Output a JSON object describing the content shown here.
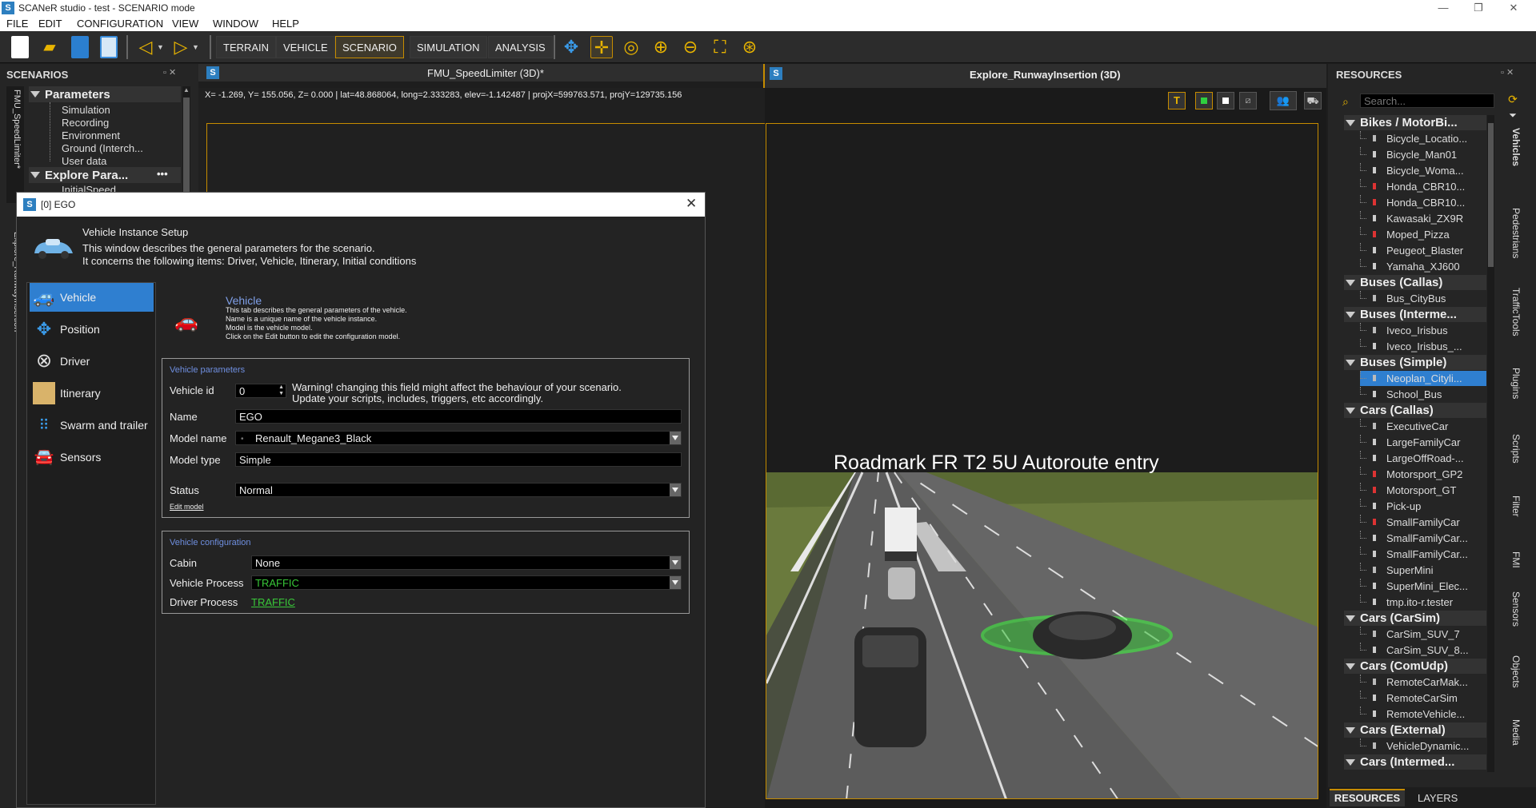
{
  "window": {
    "title": "SCANeR studio - test - SCENARIO mode",
    "icon_letter": "S"
  },
  "menu": [
    "FILE",
    "EDIT",
    "CONFIGURATION",
    "VIEW",
    "WINDOW",
    "HELP"
  ],
  "toolbar": {
    "modes": [
      "TERRAIN",
      "VEHICLE",
      "SCENARIO",
      "SIMULATION",
      "ANALYSIS"
    ],
    "active_mode": "SCENARIO"
  },
  "scenarios_panel": {
    "title": "SCENARIOS",
    "tabs": [
      "FMU_SpeedLimiter*",
      "Explore_RunwayInsertion"
    ],
    "parameters_header": "Parameters",
    "parameters_items": [
      "Simulation",
      "Recording",
      "Environment",
      "Ground (Interch...",
      "User data"
    ],
    "explore_header": "Explore Para...",
    "explore_more": "•••",
    "explore_items": [
      "InitialSpeed"
    ]
  },
  "views": {
    "left_tab_title": "FMU_SpeedLimiter (3D)*",
    "right_tab_title": "Explore_RunwayInsertion (3D)",
    "coordinates": "X= -1.269, Y= 155.056, Z= 0.000 | lat=48.868064, long=2.333283, elev=-1.142487 | projX=599763.571, projY=129735.156",
    "view_buttons": [
      "T"
    ],
    "roadmark_label": "Roadmark  FR  T2  5U  Autoroute entry"
  },
  "dialog": {
    "title": "[0] EGO",
    "header_title": "Vehicle Instance Setup",
    "header_desc_1": "This window describes the general parameters for the scenario.",
    "header_desc_2": "It concerns the following items: Driver, Vehicle, Itinerary, Initial conditions",
    "nav": [
      "Vehicle",
      "Position",
      "Driver",
      "Itinerary",
      "Swarm and trailer",
      "Sensors"
    ],
    "tab_title": "Vehicle",
    "tab_desc": [
      "This tab describes the general parameters of the vehicle.",
      "Name is a unique name of the vehicle instance.",
      "Model is the vehicle model.",
      "Click on the Edit button to edit the configuration model."
    ],
    "params_group": "Vehicle parameters",
    "vehicle_id_label": "Vehicle id",
    "vehicle_id_value": "0",
    "warning_1": "Warning! changing this field might affect the behaviour of your scenario.",
    "warning_2": "Update your scripts, includes, triggers, etc accordingly.",
    "name_label": "Name",
    "name_value": "EGO",
    "model_name_label": "Model name",
    "model_name_value": "Renault_Megane3_Black",
    "model_type_label": "Model type",
    "model_type_value": "Simple",
    "status_label": "Status",
    "status_value": "Normal",
    "edit_model": "Edit model",
    "config_group": "Vehicle configuration",
    "cabin_label": "Cabin",
    "cabin_value": "None",
    "vehicle_process_label": "Vehicle Process",
    "vehicle_process_value": "TRAFFIC",
    "driver_process_label": "Driver Process",
    "driver_process_value": "TRAFFIC"
  },
  "resources": {
    "title": "RESOURCES",
    "search_placeholder": "Search...",
    "groups": [
      {
        "name": "Bikes / MotorBi...",
        "items": [
          "Bicycle_Locatio...",
          "Bicycle_Man01",
          "Bicycle_Woma...",
          "Honda_CBR10...",
          "Honda_CBR10...",
          "Kawasaki_ZX9R",
          "Moped_Pizza",
          "Peugeot_Blaster",
          "Yamaha_XJ600"
        ]
      },
      {
        "name": "Buses (Callas)",
        "items": [
          "Bus_CityBus"
        ]
      },
      {
        "name": "Buses (Interme...",
        "items": [
          "Iveco_Irisbus",
          "Iveco_Irisbus_..."
        ]
      },
      {
        "name": "Buses (Simple)",
        "items": [
          "Neoplan_Cityli...",
          "School_Bus"
        ]
      },
      {
        "name": "Cars (Callas)",
        "items": [
          "ExecutiveCar",
          "LargeFamilyCar",
          "LargeOffRoad-...",
          "Motorsport_GP2",
          "Motorsport_GT",
          "Pick-up",
          "SmallFamilyCar",
          "SmallFamilyCar...",
          "SmallFamilyCar...",
          "SuperMini",
          "SuperMini_Elec...",
          "tmp.ito-r.tester"
        ]
      },
      {
        "name": "Cars (CarSim)",
        "items": [
          "CarSim_SUV_7",
          "CarSim_SUV_8..."
        ]
      },
      {
        "name": "Cars (ComUdp)",
        "items": [
          "RemoteCarMak...",
          "RemoteCarSim",
          "RemoteVehicle..."
        ]
      },
      {
        "name": "Cars (External)",
        "items": [
          "VehicleDynamic..."
        ]
      },
      {
        "name": "Cars (Intermed...",
        "items": []
      }
    ],
    "selected_item": "Neoplan_Cityli...",
    "side_tabs": [
      "Vehicles",
      "Pedestrians",
      "TrafficTools",
      "Plugins",
      "Scripts",
      "Filter",
      "FMI",
      "Sensors",
      "Objects",
      "Media"
    ],
    "bottom_tabs": [
      "RESOURCES",
      "LAYERS"
    ]
  },
  "colors": {
    "accent_orange": "#c68c00",
    "selection_blue": "#2f7fd0",
    "link_green": "#39c839",
    "group_label_blue": "#6f8fe0"
  }
}
